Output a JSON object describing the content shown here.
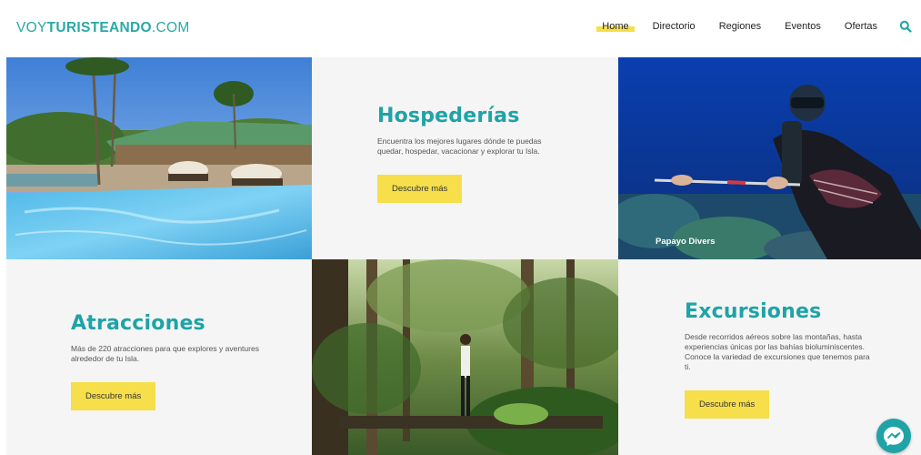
{
  "brand": {
    "light": "VOY",
    "bold": "TURISTEANDO",
    "suffix": ".COM"
  },
  "nav": {
    "items": [
      {
        "label": "Home",
        "active": true
      },
      {
        "label": "Directorio",
        "active": false
      },
      {
        "label": "Regiones",
        "active": false
      },
      {
        "label": "Eventos",
        "active": false
      },
      {
        "label": "Ofertas",
        "active": false
      }
    ],
    "search_icon": "search-icon"
  },
  "cards": {
    "hospederias": {
      "title": "Hospederías",
      "description": "Encuentra los mejores lugares dónde te puedas quedar, hospedar, vacacionar y explorar tu Isla.",
      "button": "Descubre más"
    },
    "atracciones": {
      "title": "Atracciones",
      "description": "Más de 220 atracciones para que explores y aventures alrededor de tu Isla.",
      "button": "Descubre más"
    },
    "excursiones": {
      "title": "Excursiones",
      "description": "Desde recorridos aéreos sobre las montañas, hasta experiencias únicas por las bahías bioluminiscentes. Conoce la variedad de excursiones que tenemos para ti.",
      "button": "Descubre más"
    }
  },
  "images": {
    "pool_caption": "",
    "diver_caption": "Papayo Divers",
    "forest_caption": ""
  },
  "colors": {
    "accent": "#1fa3a6",
    "highlight": "#f6df4a"
  },
  "messenger_icon": "messenger-icon"
}
